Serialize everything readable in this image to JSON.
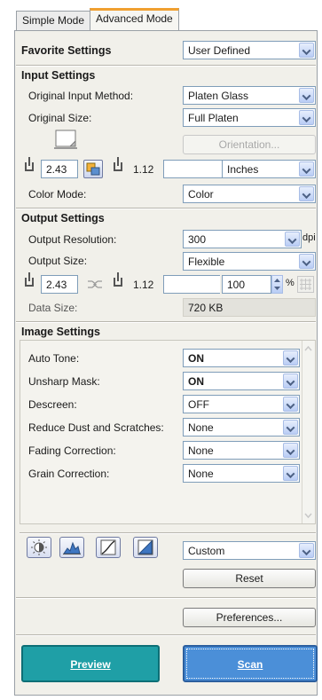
{
  "tabs": [
    "Simple Mode",
    "Advanced Mode"
  ],
  "favorite": {
    "label": "Favorite Settings",
    "value": "User Defined"
  },
  "input": {
    "title": "Input Settings",
    "method_label": "Original Input Method:",
    "method_value": "Platen Glass",
    "size_label": "Original Size:",
    "size_value": "Full Platen",
    "orientation_btn": "Orientation...",
    "width": "2.43",
    "height": "1.12",
    "unit": "Inches",
    "color_mode_label": "Color Mode:",
    "color_mode_value": "Color"
  },
  "output": {
    "title": "Output Settings",
    "resolution_label": "Output Resolution:",
    "resolution_value": "300",
    "resolution_unit": "dpi",
    "size_label": "Output Size:",
    "size_value": "Flexible",
    "width": "2.43",
    "height": "1.12",
    "scale": "100",
    "percent": "%",
    "datasize_label": "Data Size:",
    "datasize_value": "720 KB"
  },
  "image": {
    "title": "Image Settings",
    "rows": [
      {
        "label": "Auto Tone:",
        "value": "ON",
        "bold": true
      },
      {
        "label": "Unsharp Mask:",
        "value": "ON",
        "bold": true
      },
      {
        "label": "Descreen:",
        "value": "OFF",
        "bold": false
      },
      {
        "label": "Reduce Dust and Scratches:",
        "value": "None",
        "bold": false
      },
      {
        "label": "Fading Correction:",
        "value": "None",
        "bold": false
      },
      {
        "label": "Grain Correction:",
        "value": "None",
        "bold": false
      }
    ]
  },
  "tools": {
    "preset_value": "Custom",
    "reset": "Reset",
    "preferences": "Preferences...",
    "preview": "Preview",
    "scan": "Scan"
  },
  "colors": {
    "preview_bg": "#1f9fa6",
    "scan_bg": "#4b8fd8",
    "tab_accent": "#f0a030"
  }
}
